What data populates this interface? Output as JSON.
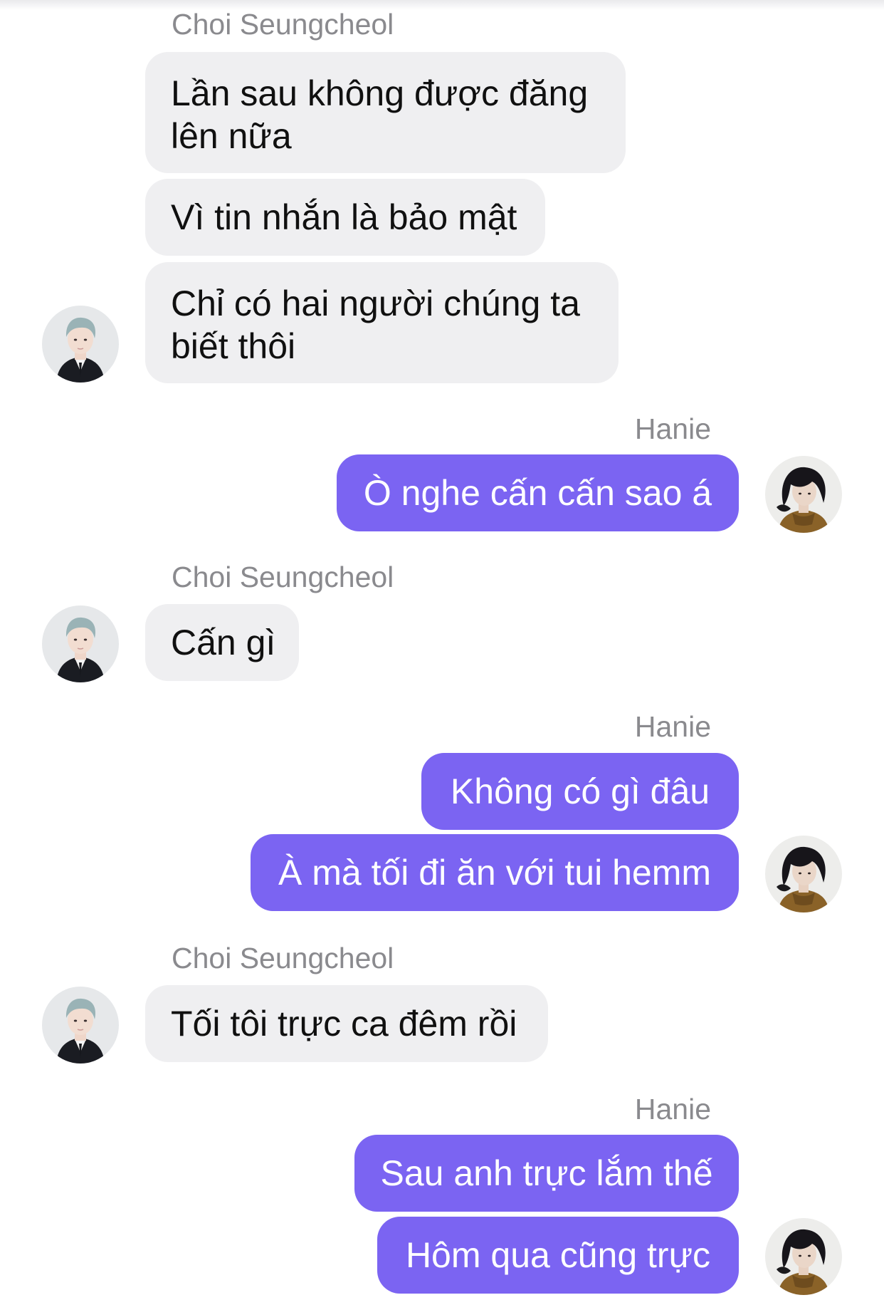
{
  "participants": {
    "other": {
      "name": "Choi Seungcheol",
      "avatar_icon": "boy-in-uniform-avatar-icon"
    },
    "me": {
      "name": "Hanie",
      "avatar_icon": "dark-haired-girl-avatar-icon"
    }
  },
  "colors": {
    "incoming_bubble": "#efeff1",
    "outgoing_bubble": "#7b64f2",
    "sender_label": "#8a8a8e"
  },
  "groups": [
    {
      "sender": "Choi Seungcheol",
      "messages": [
        "Lần sau không được đăng lên nữa",
        "Vì tin nhắn là bảo mật",
        "Chỉ có hai người chúng ta biết thôi"
      ]
    },
    {
      "sender": "Hanie",
      "messages": [
        "Ò nghe cấn cấn sao á"
      ]
    },
    {
      "sender": "Choi Seungcheol",
      "messages": [
        "Cấn gì"
      ]
    },
    {
      "sender": "Hanie",
      "messages": [
        "Không có gì đâu",
        "À mà tối đi ăn với tui hemm"
      ]
    },
    {
      "sender": "Choi Seungcheol",
      "messages": [
        "Tối tôi trực ca đêm rồi"
      ]
    },
    {
      "sender": "Hanie",
      "messages": [
        "Sau anh trực lắm thế",
        "Hôm qua cũng trực"
      ]
    }
  ]
}
